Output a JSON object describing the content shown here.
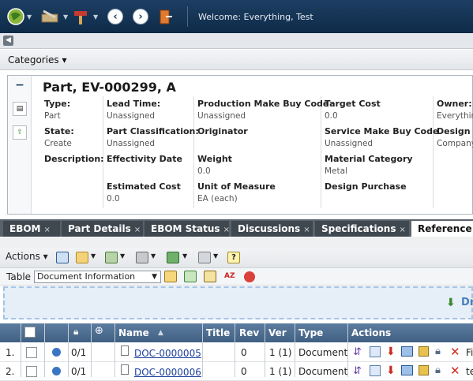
{
  "topbar": {
    "welcome": "Welcome: Everything, Test",
    "icons": [
      "globe-icon",
      "tools-icon",
      "hammer-icon",
      "back-icon",
      "forward-icon",
      "exit-icon"
    ]
  },
  "categories": {
    "label": "Categories ▾"
  },
  "part": {
    "title": "Part, EV-000299, A",
    "fields": {
      "type_label": "Type:",
      "type_value": "Part",
      "state_label": "State:",
      "state_value": "Create",
      "description_label": "Description:",
      "lead_time_label": "Lead Time:",
      "lead_time_value": "Unassigned",
      "part_class_label": "Part Classification:",
      "part_class_value": "Unassigned",
      "effectivity_label": "Effectivity Date",
      "estimated_cost_label": "Estimated Cost",
      "estimated_cost_value": "0.0",
      "prod_make_buy_label": "Production Make Buy Code",
      "prod_make_buy_value": "Unassigned",
      "originator_label": "Originator",
      "weight_label": "Weight",
      "weight_value": "0.0",
      "uom_label": "Unit of Measure",
      "uom_value": "EA (each)",
      "target_cost_label": "Target Cost",
      "target_cost_value": "0.0",
      "service_make_buy_label": "Service Make Buy Code",
      "service_make_buy_value": "Unassigned",
      "material_cat_label": "Material Category",
      "material_cat_value": "Metal",
      "design_purchase_label": "Design Purchase",
      "owner_label": "Owner:",
      "owner_value": "Everythin",
      "design_c_label": "Design C",
      "design_c_value": "Company"
    }
  },
  "tabs": [
    {
      "label": "EBOM",
      "x": "×"
    },
    {
      "label": "Part Details",
      "x": "×"
    },
    {
      "label": "EBOM Status",
      "x": "×"
    },
    {
      "label": "Discussions",
      "x": "×"
    },
    {
      "label": "Specifications",
      "x": "×"
    },
    {
      "label": "Reference",
      "x": ""
    }
  ],
  "toolbar": {
    "actions_label": "Actions ▾",
    "table_label": "Table",
    "table_value": "Document Information"
  },
  "dropzone": {
    "label": "Dr"
  },
  "grid": {
    "headers": {
      "name": "Name",
      "sort": "▲",
      "title": "Title",
      "rev": "Rev",
      "ver": "Ver",
      "type": "Type",
      "actions": "Actions"
    },
    "rows": [
      {
        "num": "1.",
        "lock": "0/1",
        "name": "DOC-0000005",
        "rev": "0",
        "ver": "1 (1)",
        "type": "Document",
        "tail": "Fi"
      },
      {
        "num": "2.",
        "lock": "0/1",
        "name": "DOC-0000006",
        "rev": "0",
        "ver": "1 (1)",
        "type": "Document",
        "tail": "te"
      }
    ]
  }
}
